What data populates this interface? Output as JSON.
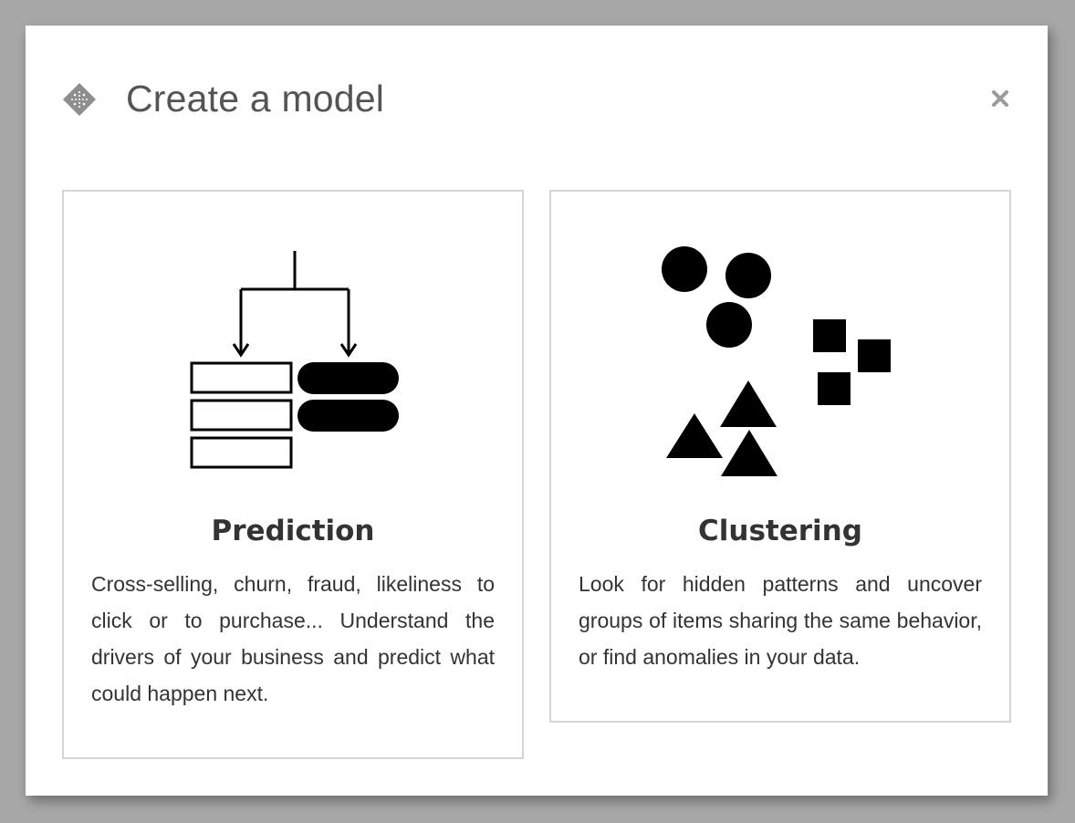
{
  "modal": {
    "title": "Create a model",
    "header_icon": "model-diamond-icon",
    "close_icon": "close-icon"
  },
  "cards": [
    {
      "id": "prediction",
      "icon": "prediction-icon",
      "title": "Prediction",
      "description": "Cross-selling, churn, fraud, likeliness to click or to purchase... Understand the drivers of your business and predict what could happen next."
    },
    {
      "id": "clustering",
      "icon": "clustering-icon",
      "title": "Clustering",
      "description": "Look for hidden patterns and uncover groups of items sharing the same behavior, or find anomalies in your data."
    }
  ],
  "colors": {
    "backdrop": "#a7a7a7",
    "modal_bg": "#ffffff",
    "card_border": "#d5d5d5",
    "title_text": "#545454",
    "body_text": "#333333",
    "icon_grey": "#999999"
  }
}
